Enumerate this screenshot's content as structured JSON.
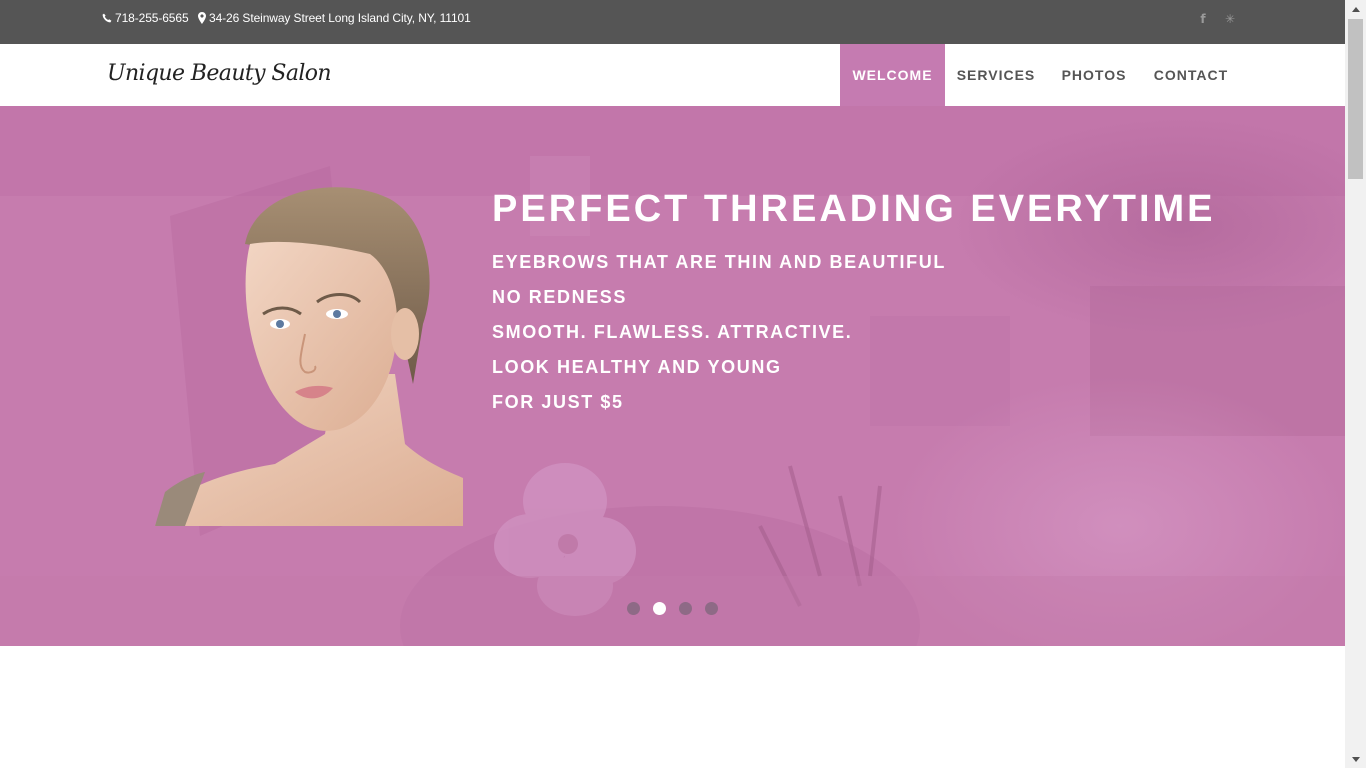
{
  "topbar": {
    "phone": "718-255-6565",
    "address": "34-26 Steinway Street Long Island City, NY, 11101",
    "social": [
      {
        "icon": "facebook-icon",
        "glyph": "f"
      },
      {
        "icon": "yelp-icon",
        "glyph": "✳"
      }
    ]
  },
  "header": {
    "logo": "Unique Beauty Salon",
    "nav": [
      {
        "label": "WELCOME",
        "active": true
      },
      {
        "label": "SERVICES",
        "active": false
      },
      {
        "label": "PHOTOS",
        "active": false
      },
      {
        "label": "CONTACT",
        "active": false
      }
    ]
  },
  "hero": {
    "title": "PERFECT THREADING EVERYTIME",
    "lines": [
      "EYEBROWS THAT ARE THIN AND BEAUTIFUL",
      "NO REDNESS",
      "SMOOTH. FLAWLESS. ATTRACTIVE.",
      "LOOK HEALTHY AND YOUNG",
      "FOR JUST $5"
    ],
    "slides_count": 4,
    "active_slide": 2
  },
  "colors": {
    "accent": "#c57bb1",
    "hero_bg": "#c77daf",
    "topbar_bg": "#555555",
    "nav_text": "#555555"
  }
}
